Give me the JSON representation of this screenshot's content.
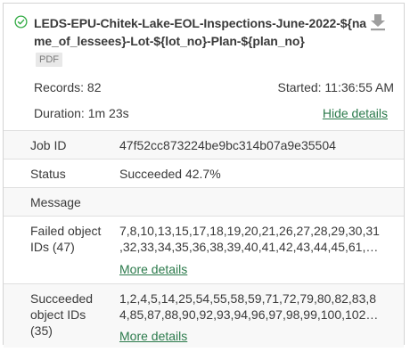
{
  "job": {
    "title": "LEDS-EPU-Chitek-Lake-EOL-Inspections-June-2022-${name_of_lessees}-Lot-${lot_no}-Plan-${plan_no}",
    "format_badge": "PDF",
    "records_text": "Records: 82",
    "started_text": "Started: 11:36:55 AM",
    "duration_text": "Duration: 1m 23s",
    "hide_details_label": "Hide details"
  },
  "details": {
    "job_id_label": "Job ID",
    "job_id_value": "47f52cc873224be9bc314b07a9e35504",
    "status_label": "Status",
    "status_value": "Succeeded 42.7%",
    "message_label": "Message",
    "message_value": "",
    "failed_label_1": "Failed object",
    "failed_label_2": "IDs (47)",
    "failed_ids_line_1": "7,8,10,13,15,17,18,19,20,21,26,27,28,29,30,31",
    "failed_ids_line_2": ",32,33,34,35,36,38,39,40,41,42,43,44,45,61,…",
    "failed_more_label": "More details",
    "succeeded_label_1": "Succeeded",
    "succeeded_label_2": "object IDs",
    "succeeded_label_3": "(35)",
    "succeeded_ids_line_1": "1,2,4,5,14,25,54,55,58,59,71,72,79,80,82,83,8",
    "succeeded_ids_line_2": "4,85,87,88,90,92,93,94,96,97,98,99,100,102…",
    "succeeded_more_label": "More details"
  },
  "icons": {
    "status": "check-circle-icon",
    "download": "download-icon"
  },
  "colors": {
    "success": "#35ac46",
    "link": "#2b7a4b",
    "download": "#9e9e9e"
  }
}
